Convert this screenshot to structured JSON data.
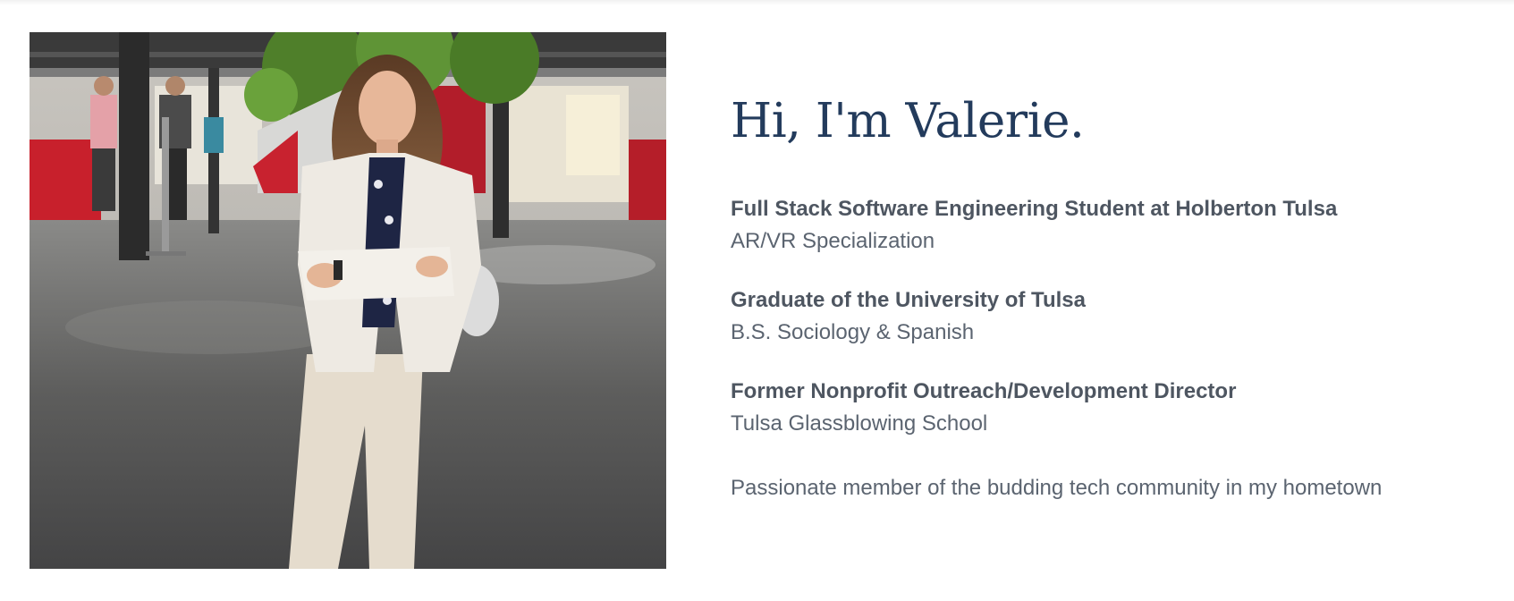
{
  "hero": {
    "greeting": "Hi, I'm Valerie."
  },
  "credentials": [
    {
      "title": "Full Stack Software Engineering Student at Holberton Tulsa",
      "subtitle": "AR/VR Specialization"
    },
    {
      "title": "Graduate of the University of Tulsa",
      "subtitle": "B.S. Sociology & Spanish"
    },
    {
      "title": "Former Nonprofit Outreach/Development Director",
      "subtitle": "Tulsa Glassblowing School"
    }
  ],
  "tagline": "Passionate member of the budding tech community in my hometown",
  "colors": {
    "heading": "#233b5c",
    "title_text": "#4e5661",
    "body_text": "#5b6470"
  }
}
